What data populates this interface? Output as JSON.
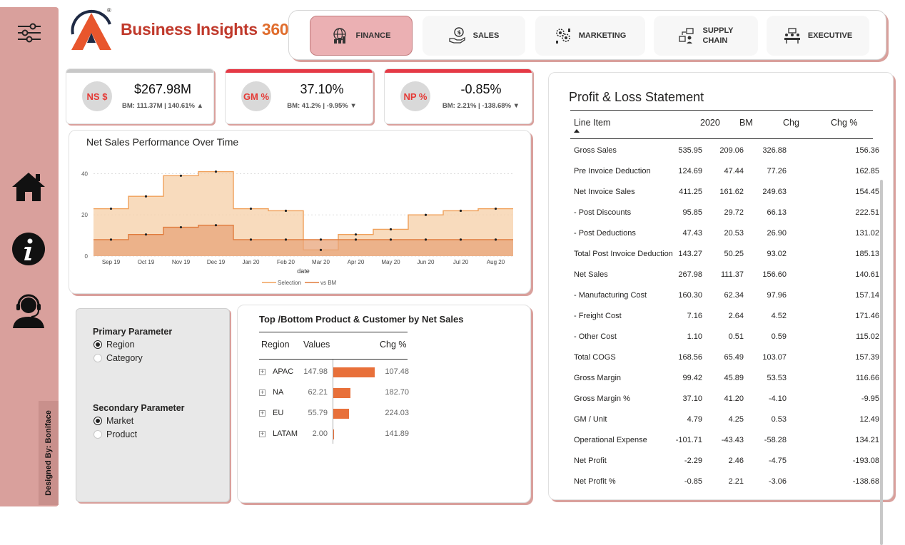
{
  "brand": {
    "name": "Business Insights ",
    "number": "360",
    "registered": "®"
  },
  "sidebar": {
    "designed_by": "Designed By: Boniface"
  },
  "nav": [
    {
      "label": "FINANCE",
      "active": true,
      "icon": "finance-globe-icon"
    },
    {
      "label": "SALES",
      "active": false,
      "icon": "sales-money-icon"
    },
    {
      "label": "MARKETING",
      "active": false,
      "icon": "marketing-gears-icon"
    },
    {
      "label_line1": "SUPPLY",
      "label_line2": "CHAIN",
      "active": false,
      "icon": "supply-chain-icon"
    },
    {
      "label": "EXECUTIVE",
      "active": false,
      "icon": "executive-meeting-icon"
    }
  ],
  "kpis": [
    {
      "badge": "NS $",
      "value": "$267.98M",
      "bm": "BM: 111.37M | 140.61% ▲",
      "bar_color": "#c8c8c8"
    },
    {
      "badge": "GM %",
      "value": "37.10%",
      "bm": "BM: 41.2% | -9.95% ▼",
      "bar_color": "#e53945"
    },
    {
      "badge": "NP %",
      "value": "-0.85%",
      "bm": "BM: 2.21% | -138.68% ▼",
      "bar_color": "#e53945"
    }
  ],
  "chart_data": {
    "type": "area",
    "title": "Net Sales Performance Over Time",
    "xlabel": "date",
    "ylabel": "",
    "x": [
      "Sep 19",
      "Oct 19",
      "Nov 19",
      "Dec 19",
      "Jan 20",
      "Feb 20",
      "Mar 20",
      "Apr 20",
      "May 20",
      "Jun 20",
      "Jul 20",
      "Aug 20"
    ],
    "ylim": [
      0,
      45
    ],
    "yticks": [
      0,
      20,
      40
    ],
    "grid": true,
    "legend_position": "bottom",
    "series": [
      {
        "name": "Selection",
        "values": [
          23,
          29,
          39,
          41,
          23,
          22,
          3,
          10.5,
          13,
          20,
          22,
          23
        ]
      },
      {
        "name": "vs BM",
        "values": [
          8,
          10.5,
          14,
          15,
          8,
          8,
          8,
          8,
          8,
          8,
          8,
          8
        ]
      }
    ]
  },
  "params": {
    "primary": {
      "title": "Primary Parameter",
      "options": [
        {
          "label": "Region",
          "selected": true
        },
        {
          "label": "Category",
          "selected": false
        }
      ]
    },
    "secondary": {
      "title": "Secondary Parameter",
      "options": [
        {
          "label": "Market",
          "selected": true
        },
        {
          "label": "Product",
          "selected": false
        }
      ]
    }
  },
  "topbottom": {
    "title": "Top /Bottom Product & Customer by Net Sales",
    "headers": {
      "region": "Region",
      "values": "Values",
      "chg": "Chg %"
    },
    "rows": [
      {
        "region": "APAC",
        "value": "147.98",
        "num": 147.98,
        "chg": "107.48"
      },
      {
        "region": "NA",
        "value": "62.21",
        "num": 62.21,
        "chg": "182.70"
      },
      {
        "region": "EU",
        "value": "55.79",
        "num": 55.79,
        "chg": "224.03"
      },
      {
        "region": "LATAM",
        "value": "2.00",
        "num": 2.0,
        "chg": "141.89"
      }
    ]
  },
  "pl": {
    "title": "Profit & Loss Statement",
    "headers": {
      "line": "Line Item",
      "y2020": "2020",
      "bm": "BM",
      "chg": "Chg",
      "pct": "Chg %"
    },
    "rows": [
      {
        "item": "Gross Sales",
        "v2020": "535.95",
        "bm": "209.06",
        "chg": "326.88",
        "pct": "156.36"
      },
      {
        "item": "Pre Invoice Deduction",
        "v2020": "124.69",
        "bm": "47.44",
        "chg": "77.26",
        "pct": "162.85"
      },
      {
        "item": "Net Invoice Sales",
        "v2020": "411.25",
        "bm": "161.62",
        "chg": "249.63",
        "pct": "154.45"
      },
      {
        "item": "- Post Discounts",
        "v2020": "95.85",
        "bm": "29.72",
        "chg": "66.13",
        "pct": "222.51"
      },
      {
        "item": "- Post Deductions",
        "v2020": "47.43",
        "bm": "20.53",
        "chg": "26.90",
        "pct": "131.02"
      },
      {
        "item": "Total Post Invoice Deduction",
        "v2020": "143.27",
        "bm": "50.25",
        "chg": "93.02",
        "pct": "185.13"
      },
      {
        "item": "Net Sales",
        "v2020": "267.98",
        "bm": "111.37",
        "chg": "156.60",
        "pct": "140.61"
      },
      {
        "item": "- Manufacturing Cost",
        "v2020": "160.30",
        "bm": "62.34",
        "chg": "97.96",
        "pct": "157.14"
      },
      {
        "item": "- Freight Cost",
        "v2020": "7.16",
        "bm": "2.64",
        "chg": "4.52",
        "pct": "171.46"
      },
      {
        "item": "- Other Cost",
        "v2020": "1.10",
        "bm": "0.51",
        "chg": "0.59",
        "pct": "115.02"
      },
      {
        "item": "Total COGS",
        "v2020": "168.56",
        "bm": "65.49",
        "chg": "103.07",
        "pct": "157.39"
      },
      {
        "item": "Gross Margin",
        "v2020": "99.42",
        "bm": "45.89",
        "chg": "53.53",
        "pct": "116.66"
      },
      {
        "item": "Gross Margin %",
        "v2020": "37.10",
        "bm": "41.20",
        "chg": "-4.10",
        "pct": "-9.95"
      },
      {
        "item": "GM / Unit",
        "v2020": "4.79",
        "bm": "4.25",
        "chg": "0.53",
        "pct": "12.49"
      },
      {
        "item": "Operational Expense",
        "v2020": "-101.71",
        "bm": "-43.43",
        "chg": "-58.28",
        "pct": "134.21"
      },
      {
        "item": "Net Profit",
        "v2020": "-2.29",
        "bm": "2.46",
        "chg": "-4.75",
        "pct": "-193.08"
      },
      {
        "item": "Net Profit %",
        "v2020": "-0.85",
        "bm": "2.21",
        "chg": "-3.06",
        "pct": "-138.68"
      }
    ]
  }
}
